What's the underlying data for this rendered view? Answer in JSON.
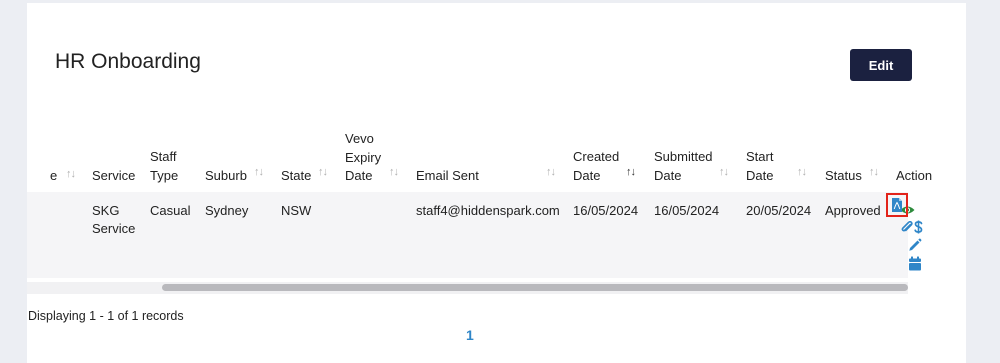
{
  "page": {
    "title": "HR Onboarding",
    "edit_label": "Edit"
  },
  "table": {
    "partial_first_header": "e",
    "headers": {
      "service": [
        "Service"
      ],
      "staff_type": [
        "Staff",
        "Type"
      ],
      "suburb": [
        "Suburb"
      ],
      "state": [
        "State"
      ],
      "vevo": [
        "Vevo",
        "Expiry",
        "Date"
      ],
      "email": [
        "Email Sent"
      ],
      "created": [
        "Created",
        "Date"
      ],
      "submitted": [
        "Submitted",
        "Date"
      ],
      "start": [
        "Start",
        "Date"
      ],
      "status": [
        "Status"
      ],
      "action": [
        "Action"
      ]
    },
    "sort_glyph": "↑↓",
    "active_sort_glyph": "↑↓",
    "row": {
      "service": [
        "SKG",
        "Service"
      ],
      "staff_type": "Casual",
      "suburb": "Sydney",
      "state": "NSW",
      "email": "staff4@hiddenspark.com",
      "created": "16/05/2024",
      "submitted": "16/05/2024",
      "start": "20/05/2024",
      "status": "Approved"
    },
    "action_icons": [
      "eye-icon",
      "pdf-document-icon",
      "paperclip-icon",
      "dollar-icon",
      "pencil-icon",
      "calendar-icon"
    ]
  },
  "footer": {
    "records": "Displaying 1 - 1 of 1 records",
    "page": "1"
  },
  "colors": {
    "accent_blue": "#2f86c8",
    "eye_green": "#2e8b3d",
    "button_navy": "#1b2140",
    "highlight_red": "#e2231a"
  }
}
